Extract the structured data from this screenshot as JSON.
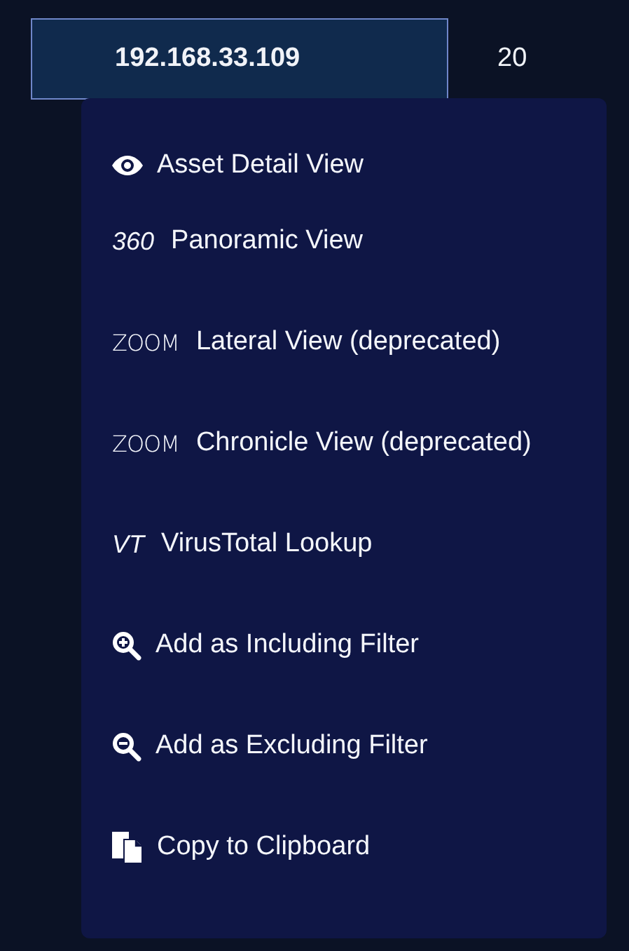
{
  "cell": {
    "value": "192.168.33.109",
    "selected": true
  },
  "next_cell": {
    "value": "20"
  },
  "menu": {
    "items": [
      {
        "kind": "eye",
        "label": "Asset Detail View"
      },
      {
        "kind": "italic-tag",
        "tag": "360",
        "label": "Panoramic View"
      },
      {
        "kind": "thin-tag",
        "tag": "ZOOM",
        "label": "Lateral View (deprecated)"
      },
      {
        "kind": "thin-tag",
        "tag": "ZOOM",
        "label": "Chronicle View (deprecated)"
      },
      {
        "kind": "italic-tag",
        "tag": "VT",
        "label": "VirusTotal Lookup"
      },
      {
        "kind": "zoom-in",
        "label": "Add as Including Filter"
      },
      {
        "kind": "zoom-out",
        "label": "Add as Excluding Filter"
      },
      {
        "kind": "copy",
        "label": "Copy to Clipboard"
      }
    ]
  }
}
